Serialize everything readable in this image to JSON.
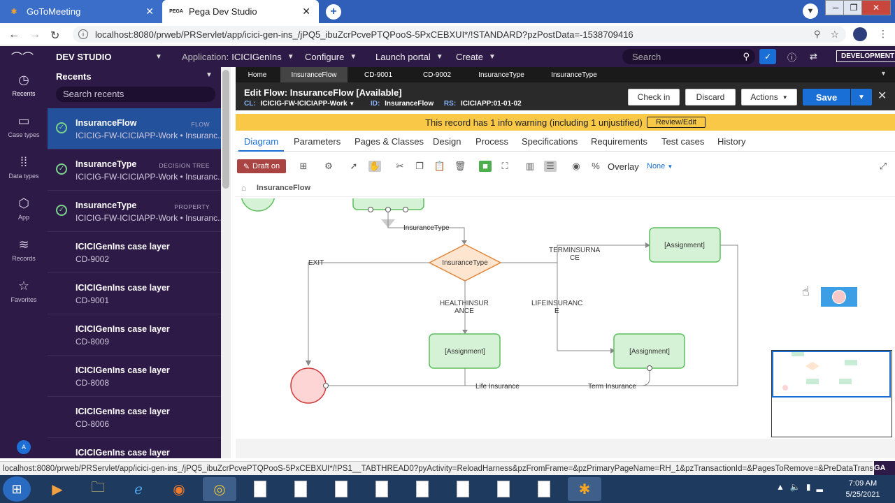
{
  "browser": {
    "tabs": [
      {
        "label": "GoToMeeting",
        "active": false
      },
      {
        "label": "Pega Dev Studio",
        "active": true
      }
    ],
    "url": "localhost:8080/prweb/PRServlet/app/icici-gen-ins_/jPQ5_ibuZcrPcvePTQPooS-5PxCEBXUI*/!STANDARD?pzPostData=-1538709416",
    "status_url": "localhost:8080/prweb/PRServlet/app/icici-gen-ins_/jPQ5_ibuZcrPcvePTQPooS-5PxCEBXUI*/!PS1__TABTHREAD0?pyActivity=ReloadHarness&pzFromFrame=&pzPrimaryPageName=RH_1&pzTransactionId=&PagesToRemove=&PreDataTransform=&P...",
    "status_right": "GA"
  },
  "header": {
    "studio": "DEV STUDIO",
    "application_label": "Application:",
    "application_value": "ICICIGenIns",
    "configure": "Configure",
    "launch_portal": "Launch portal",
    "create": "Create",
    "search_placeholder": "Search",
    "environment": "DEVELOPMENT"
  },
  "leftnav": [
    {
      "label": "Recents",
      "icon": "clock-icon"
    },
    {
      "label": "Case types",
      "icon": "case-icon"
    },
    {
      "label": "Data types",
      "icon": "data-icon"
    },
    {
      "label": "App",
      "icon": "cube-icon"
    },
    {
      "label": "Records",
      "icon": "stack-icon"
    },
    {
      "label": "Favorites",
      "icon": "star-icon"
    }
  ],
  "avatar": "A",
  "recents": {
    "title": "Recents",
    "search_placeholder": "Search recents",
    "items": [
      {
        "name": "InsuranceFlow",
        "type": "FLOW",
        "sub": "ICICIG-FW-ICICIAPP-Work • Insuranc...",
        "checked": true
      },
      {
        "name": "InsuranceType",
        "type": "DECISION TREE",
        "sub": "ICICIG-FW-ICICIAPP-Work • Insuranc...",
        "checked": true
      },
      {
        "name": "InsuranceType",
        "type": "PROPERTY",
        "sub": "ICICIG-FW-ICICIAPP-Work • Insuranc...",
        "checked": true
      },
      {
        "name": "ICICIGenIns case layer",
        "type": "",
        "sub": "CD-9002",
        "checked": false
      },
      {
        "name": "ICICIGenIns case layer",
        "type": "",
        "sub": "CD-9001",
        "checked": false
      },
      {
        "name": "ICICIGenIns case layer",
        "type": "",
        "sub": "CD-8009",
        "checked": false
      },
      {
        "name": "ICICIGenIns case layer",
        "type": "",
        "sub": "CD-8008",
        "checked": false
      },
      {
        "name": "ICICIGenIns case layer",
        "type": "",
        "sub": "CD-8006",
        "checked": false
      },
      {
        "name": "ICICIGenIns case layer",
        "type": "",
        "sub": "",
        "checked": false
      }
    ]
  },
  "record_tabs": [
    "Home",
    "InsuranceFlow",
    "CD-9001",
    "CD-9002",
    "InsuranceType",
    "InsuranceType"
  ],
  "edit": {
    "title": "Edit  Flow: InsuranceFlow [Available]",
    "cl_label": "CL:",
    "cl_value": "ICICIG-FW-ICICIAPP-Work",
    "id_label": "ID:",
    "id_value": "InsuranceFlow",
    "rs_label": "RS:",
    "rs_value": "ICICIAPP:01-01-02",
    "check_in": "Check in",
    "discard": "Discard",
    "actions": "Actions",
    "save": "Save"
  },
  "warning": {
    "text": "This record has 1 info warning (including 1 unjustified)",
    "button": "Review/Edit"
  },
  "sub_tabs": [
    "Diagram",
    "Parameters",
    "Pages & Classes",
    "Design",
    "Process",
    "Specifications",
    "Requirements",
    "Test cases",
    "History"
  ],
  "toolbar": {
    "draft": "Draft on",
    "overlay_label": "Overlay",
    "overlay_value": "None"
  },
  "breadcrumb": "InsuranceFlow",
  "diagram": {
    "decision_label": "InsuranceType",
    "assignment_label": "[Assignment]",
    "connectors": {
      "insurance_type": "InsuranceType",
      "exit": "EXIT",
      "term_1": "TERMINSURNA",
      "term_2": "CE",
      "health_1": "HEALTHINSUR",
      "health_2": "ANCE",
      "life_1": "LIFEINSURANC",
      "life_2": "E",
      "life_insurance": "Life Insurance",
      "term_insurance": "Term Insurance"
    }
  },
  "taskbar": {
    "time": "7:09 AM",
    "date": "5/25/2021"
  }
}
